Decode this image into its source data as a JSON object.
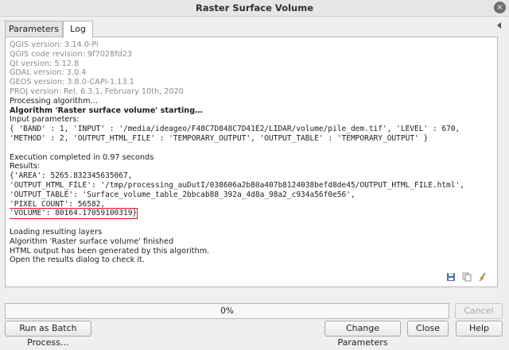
{
  "window": {
    "title": "Raster Surface Volume",
    "close_glyph": "×"
  },
  "tabs": [
    {
      "label": "Parameters",
      "active": false
    },
    {
      "label": "Log",
      "active": true
    }
  ],
  "log": {
    "lines": [
      "QGIS version: 3.14.0-Pi",
      "QGIS code revision: 9f7028fd23",
      "Qt version: 5.12.8",
      "GDAL version: 3.0.4",
      "GEOS version: 3.8.0-CAPI-1.13.1",
      "PROJ version: Rel. 6.3.1, February 10th, 2020",
      "Processing algorithm…",
      "Algorithm 'Raster surface volume' starting…",
      "Input parameters:",
      "{ 'BAND' : 1, 'INPUT' : '/media/ideageo/F48C7D848C7D41E2/LIDAR/volume/pile_dem.tif', 'LEVEL' : 670,",
      "'METHOD' : 2, 'OUTPUT_HTML_FILE' : 'TEMPORARY_OUTPUT', 'OUTPUT_TABLE' : 'TEMPORARY_OUTPUT' }",
      "",
      "Execution completed in 0.97 seconds",
      "Results:",
      "{'AREA': 5265.832345635067,",
      "'OUTPUT_HTML_FILE': '/tmp/processing_auDutI/038606a2b80a407b8124038befd8de45/OUTPUT_HTML_FILE.html',",
      "'OUTPUT_TABLE': 'Surface_volume_table_2bbcab88_392a_4d8a_98a2_c934a56f0e56',",
      "'PIXEL_COUNT': 56582,",
      "'VOLUME': 80164.17059100319}",
      "",
      "Loading resulting layers",
      "Algorithm 'Raster surface volume' finished",
      "HTML output has been generated by this algorithm.",
      "Open the results dialog to check it."
    ]
  },
  "log_tools": {
    "save_icon": "save-log-icon",
    "copy_icon": "copy-log-icon",
    "clear_icon": "clear-log-icon"
  },
  "progress": {
    "value": 0,
    "label": "0%"
  },
  "buttons": {
    "cancel": "Cancel",
    "batch": "Run as Batch Process…",
    "change_params": "Change Parameters",
    "close": "Close",
    "help": "Help"
  },
  "colors": {
    "accent": "#3d7fd0",
    "highlight_box": "#e0141e",
    "gray_text": "#8c8c8c"
  }
}
